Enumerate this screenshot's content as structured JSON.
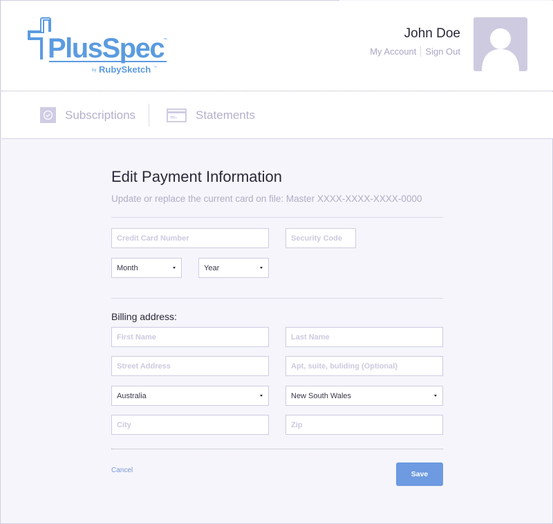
{
  "brand": {
    "name": "PlusSpec",
    "tagline": "by RubySketch",
    "trademark": "™",
    "color": "#5b9be0"
  },
  "user": {
    "name": "John Doe",
    "links": [
      {
        "label": "My Account"
      },
      {
        "label": "Sign Out"
      }
    ],
    "avatar_icon": "user-silhouette-icon"
  },
  "nav": {
    "items": [
      {
        "label": "Subscriptions",
        "icon": "check-circle-icon"
      },
      {
        "label": "Statements",
        "icon": "credit-card-icon"
      }
    ]
  },
  "form": {
    "title": "Edit Payment Information",
    "subtitle": "Update or replace the current card on file: Master XXXX-XXXX-XXXX-0000",
    "card_number": {
      "placeholder": "Credit Card Number",
      "value": ""
    },
    "security_code": {
      "placeholder": "Security Code",
      "value": ""
    },
    "month": {
      "selected": "Month"
    },
    "year": {
      "selected": "Year"
    },
    "billing_label": "Billing address:",
    "first_name": {
      "placeholder": "First Name",
      "value": ""
    },
    "last_name": {
      "placeholder": "Last Name",
      "value": ""
    },
    "street": {
      "placeholder": "Street Address",
      "value": ""
    },
    "apt": {
      "placeholder": "Apt, suite, buliding (Optional)",
      "value": ""
    },
    "country": {
      "selected": "Australia"
    },
    "state": {
      "selected": "New South Wales"
    },
    "city": {
      "placeholder": "City",
      "value": ""
    },
    "zip": {
      "placeholder": "Zip",
      "value": ""
    },
    "cancel_label": "Cancel",
    "save_label": "Save"
  },
  "colors": {
    "accent": "#6d9ae0",
    "link": "#7a98d6",
    "muted": "#b3b0cc",
    "background": "#f5f5fb"
  }
}
